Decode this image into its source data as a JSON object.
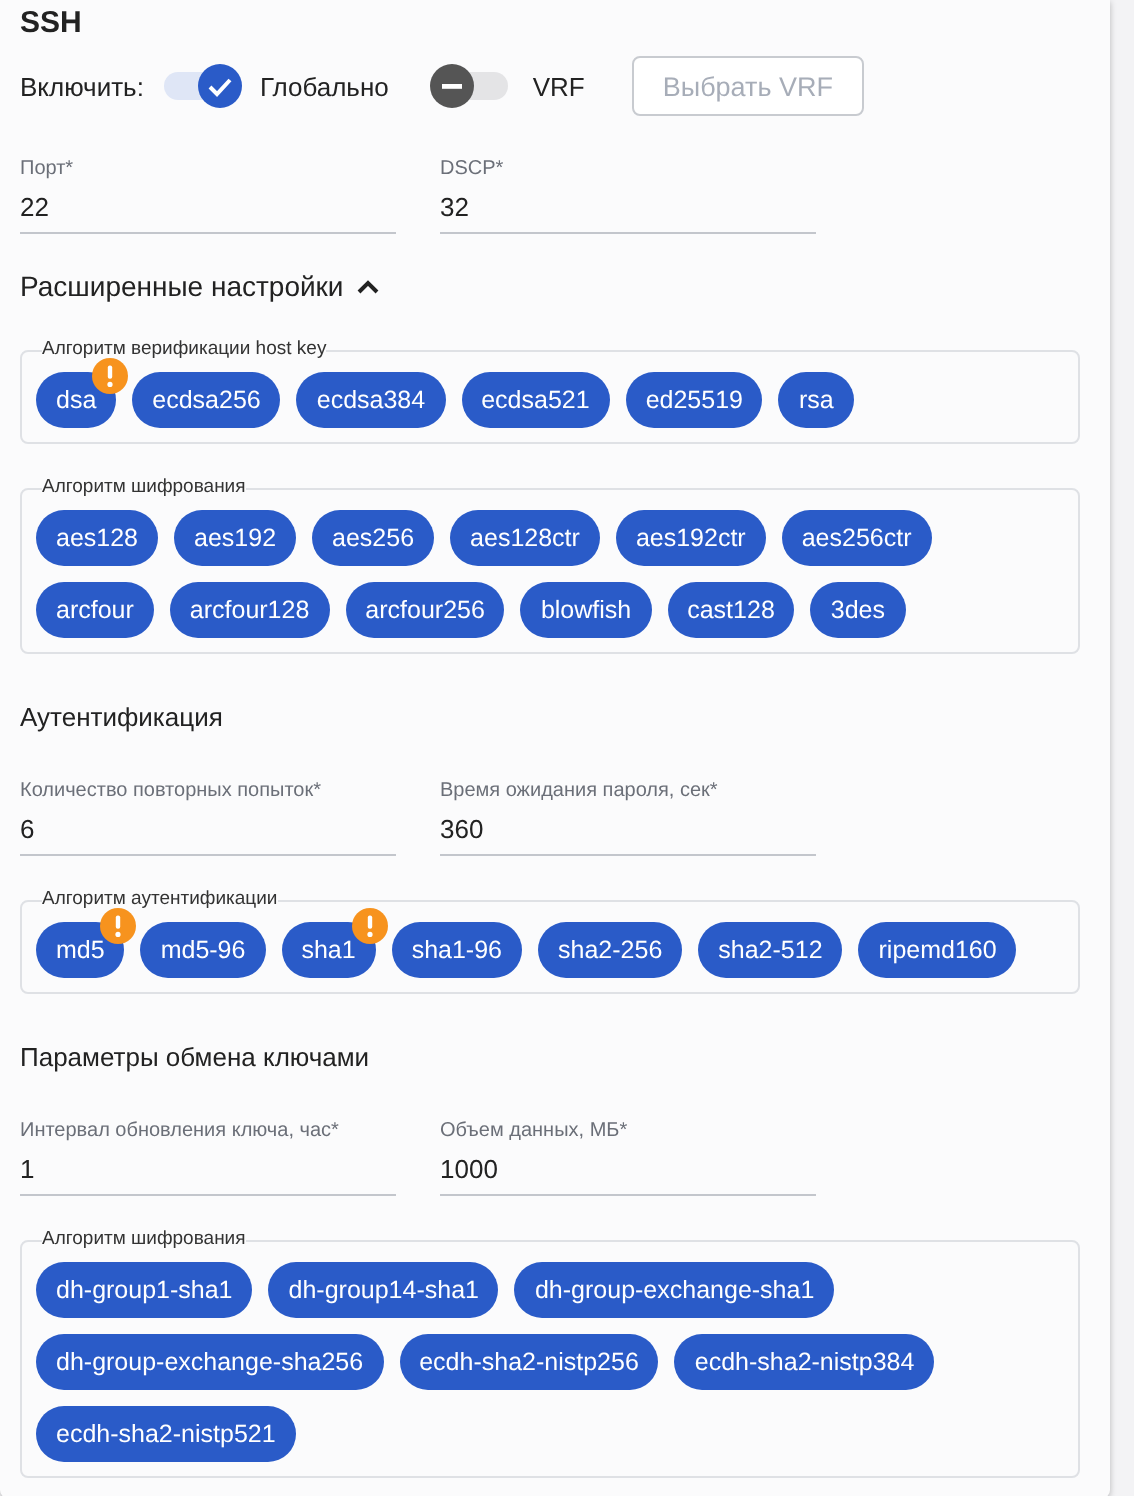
{
  "title": "SSH",
  "enable": {
    "label": "Включить:",
    "toggles": [
      {
        "label": "Глобально",
        "on": true
      },
      {
        "label": "VRF",
        "on": false
      }
    ],
    "button": {
      "label": "Выбрать VRF",
      "disabled": true
    }
  },
  "blocks": [
    {
      "kind": "fields",
      "fields": [
        {
          "label": "Порт*",
          "value": "22"
        },
        {
          "label": "DSCP*",
          "value": "32"
        }
      ]
    },
    {
      "kind": "expander",
      "label": "Расширенные настройки",
      "expanded": true
    },
    {
      "kind": "chips",
      "label": "Алгоритм верификации host key",
      "chips": [
        {
          "text": "dsa",
          "warning": true
        },
        {
          "text": "ecdsa256",
          "warning": false
        },
        {
          "text": "ecdsa384",
          "warning": false
        },
        {
          "text": "ecdsa521",
          "warning": false
        },
        {
          "text": "ed25519",
          "warning": false
        },
        {
          "text": "rsa",
          "warning": false
        }
      ]
    },
    {
      "kind": "chips",
      "label": "Алгоритм шифрования",
      "chips": [
        {
          "text": "aes128",
          "warning": false
        },
        {
          "text": "aes192",
          "warning": false
        },
        {
          "text": "aes256",
          "warning": false
        },
        {
          "text": "aes128ctr",
          "warning": false
        },
        {
          "text": "aes192ctr",
          "warning": false
        },
        {
          "text": "aes256ctr",
          "warning": false
        },
        {
          "text": "arcfour",
          "warning": false
        },
        {
          "text": "arcfour128",
          "warning": false
        },
        {
          "text": "arcfour256",
          "warning": false
        },
        {
          "text": "blowfish",
          "warning": false
        },
        {
          "text": "cast128",
          "warning": false
        },
        {
          "text": "3des",
          "warning": false
        }
      ]
    },
    {
      "kind": "heading",
      "label": "Аутентификация"
    },
    {
      "kind": "fields",
      "fields": [
        {
          "label": "Количество повторных попыток*",
          "value": "6"
        },
        {
          "label": "Время ожидания пароля, сек*",
          "value": "360"
        }
      ]
    },
    {
      "kind": "chips",
      "label": "Алгоритм аутентификации",
      "chips": [
        {
          "text": "md5",
          "warning": true
        },
        {
          "text": "md5-96",
          "warning": false
        },
        {
          "text": "sha1",
          "warning": true
        },
        {
          "text": "sha1-96",
          "warning": false
        },
        {
          "text": "sha2-256",
          "warning": false
        },
        {
          "text": "sha2-512",
          "warning": false
        },
        {
          "text": "ripemd160",
          "warning": false
        }
      ]
    },
    {
      "kind": "heading",
      "label": "Параметры обмена ключами"
    },
    {
      "kind": "fields",
      "fields": [
        {
          "label": "Интервал обновления ключа, час*",
          "value": "1"
        },
        {
          "label": "Объем данных, МБ*",
          "value": "1000"
        }
      ]
    },
    {
      "kind": "chips",
      "label": "Алгоритм шифрования",
      "chips": [
        {
          "text": "dh-group1-sha1",
          "warning": false
        },
        {
          "text": "dh-group14-sha1",
          "warning": false
        },
        {
          "text": "dh-group-exchange-sha1",
          "warning": false
        },
        {
          "text": "dh-group-exchange-sha256",
          "warning": false
        },
        {
          "text": "ecdh-sha2-nistp256",
          "warning": false
        },
        {
          "text": "ecdh-sha2-nistp384",
          "warning": false
        },
        {
          "text": "ecdh-sha2-nistp521",
          "warning": false
        }
      ]
    }
  ]
}
